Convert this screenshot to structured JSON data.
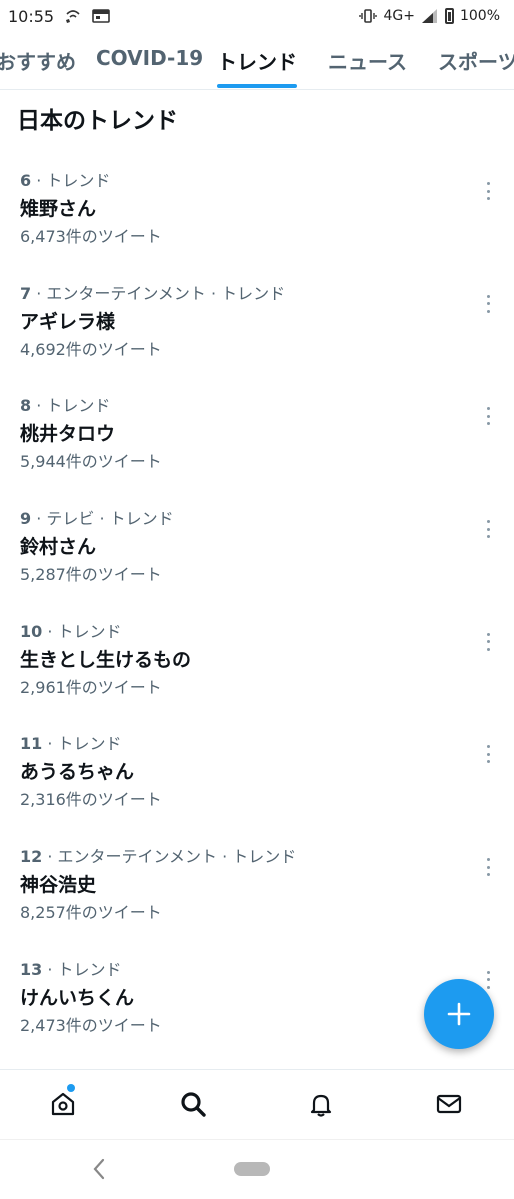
{
  "status_bar": {
    "time": "10:55",
    "network": "4G+",
    "battery": "100%"
  },
  "tabs": [
    {
      "label": "おすすめ",
      "active": false
    },
    {
      "label": "COVID-19",
      "active": false
    },
    {
      "label": "トレンド",
      "active": true
    },
    {
      "label": "ニュース",
      "active": false
    },
    {
      "label": "スポーツ",
      "active": false
    }
  ],
  "section_title": "日本のトレンド",
  "trends": [
    {
      "rank": "6",
      "category": "トレンド",
      "name": "雉野さん",
      "count": "6,473件のツイート"
    },
    {
      "rank": "7",
      "category": "エンターテインメント · トレンド",
      "name": "アギレラ様",
      "count": "4,692件のツイート"
    },
    {
      "rank": "8",
      "category": "トレンド",
      "name": "桃井タロウ",
      "count": "5,944件のツイート"
    },
    {
      "rank": "9",
      "category": "テレビ · トレンド",
      "name": "鈴村さん",
      "count": "5,287件のツイート"
    },
    {
      "rank": "10",
      "category": "トレンド",
      "name": "生きとし生けるもの",
      "count": "2,961件のツイート"
    },
    {
      "rank": "11",
      "category": "トレンド",
      "name": "あうるちゃん",
      "count": "2,316件のツイート"
    },
    {
      "rank": "12",
      "category": "エンターテインメント · トレンド",
      "name": "神谷浩史",
      "count": "8,257件のツイート"
    },
    {
      "rank": "13",
      "category": "トレンド",
      "name": "けんいちくん",
      "count": "2,473件のツイート"
    }
  ],
  "colors": {
    "accent": "#1d9bf0",
    "text_primary": "#0f1419",
    "text_secondary": "#536471"
  },
  "icons": {
    "fab": "plus-icon",
    "nav": [
      "home-icon",
      "search-icon",
      "bell-icon",
      "mail-icon"
    ]
  }
}
